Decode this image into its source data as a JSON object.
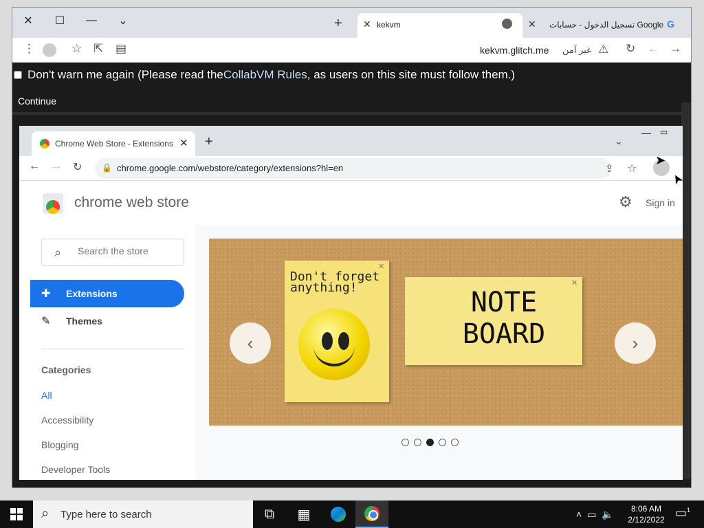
{
  "outer_browser": {
    "tabs": [
      {
        "title": "kekvm",
        "active": true
      },
      {
        "title": "تسجيل الدخول - حسابات Google",
        "active": false
      }
    ],
    "url": "kekvm.glitch.me",
    "security_label": "غير آمن"
  },
  "collabvm": {
    "warning_text_before": "Don't warn me again (Please read the ",
    "rules_link": "CollabVM Rules",
    "warning_text_after": ", as users on this site must follow them.)",
    "continue_label": "Continue"
  },
  "inner_browser": {
    "tab_title": "Chrome Web Store - Extensions",
    "url": "chrome.google.com/webstore/category/extensions?hl=en"
  },
  "webstore": {
    "name": "chrome web store",
    "sign_in": "Sign in",
    "search_placeholder": "Search the store",
    "nav": [
      {
        "label": "Extensions",
        "active": true
      },
      {
        "label": "Themes",
        "active": false
      }
    ],
    "categories_title": "Categories",
    "categories": [
      "All",
      "Accessibility",
      "Blogging",
      "Developer Tools"
    ],
    "banner": {
      "note1_text": "Don't forget anything!",
      "note2_text": "NOTE BOARD",
      "carousel_total": 5,
      "carousel_active": 3
    }
  },
  "taskbar": {
    "search_placeholder": "Type here to search",
    "time": "8:06 AM",
    "date": "2/12/2022",
    "notification_count": "1"
  },
  "colors": {
    "accent": "#1a73e8",
    "vm_background": "#1b1b1b",
    "taskbar": "#101010"
  }
}
